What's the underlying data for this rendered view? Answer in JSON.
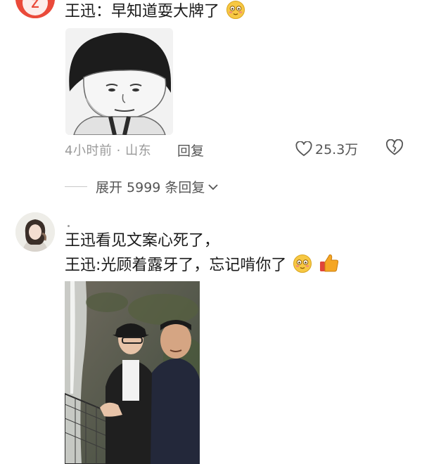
{
  "comments": [
    {
      "text": "王迅：早知道耍大牌了",
      "meta": {
        "time_location": "4小时前 · 山东",
        "reply_label": "回复",
        "like_count": "25.3万"
      },
      "expand_label": "展开 5999 条回复"
    },
    {
      "lines": [
        "王迅看见文案心死了，",
        "王迅:光顾着露牙了，忘记啃你了"
      ]
    }
  ],
  "icons": {
    "avatar_badge_letter": "Z",
    "heart": "heart-outline-icon",
    "dislike": "broken-heart-icon",
    "chevron": "chevron-down-icon",
    "emoji_blush": "blush-smile-emoji",
    "emoji_thumbs": "thumbs-up-emoji"
  },
  "colors": {
    "text": "#1a1a1a",
    "meta": "#9a9a9a",
    "action": "#555555",
    "avatar1": "#ea4a3a",
    "emoji_face": "#f7c843",
    "thumb": "#f5a623"
  }
}
